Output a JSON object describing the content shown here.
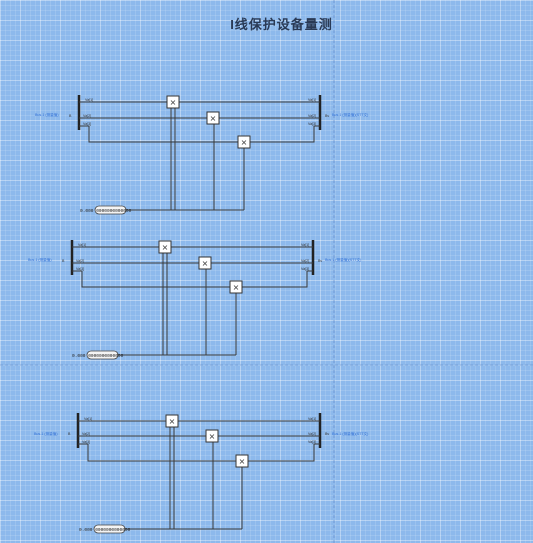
{
  "title": "I线保护设备量测",
  "diagrams": [
    {
      "left_label": "Bus-1 (测量值)",
      "right_label": "Bus-1 (测量值)(STT文)",
      "in_ports": [
        "Va[1]",
        "Va[2]",
        "Va[3]"
      ],
      "left_extra": "B",
      "right_ports": [
        "Va[1]",
        "Va[2]",
        "Va[3]"
      ],
      "right_extra": "Bv",
      "display_value": "0.000 0000000000000"
    },
    {
      "left_label": "Bus-1 (测量值)",
      "right_label": "Bus-1 (测量值)(STT文)",
      "in_ports": [
        "Va[1]",
        "Va[2]",
        "Va[3]"
      ],
      "left_extra": "B",
      "right_ports": [
        "Va[1]",
        "Va[2]",
        "Va[3]"
      ],
      "right_extra": "Bv",
      "display_value": "0.000 0000000000000"
    },
    {
      "left_label": "Bus-1 (测量值)",
      "right_label": "Bus-1 (测量值)(STT文)",
      "in_ports": [
        "Va[1]",
        "Va[2]",
        "Va[3]"
      ],
      "left_extra": "B",
      "right_ports": [
        "Va[1]",
        "Va[2]",
        "Va[3]"
      ],
      "right_extra": "Bv",
      "display_value": "0.000 0000000000000"
    }
  ],
  "multiplier_symbol": "×"
}
